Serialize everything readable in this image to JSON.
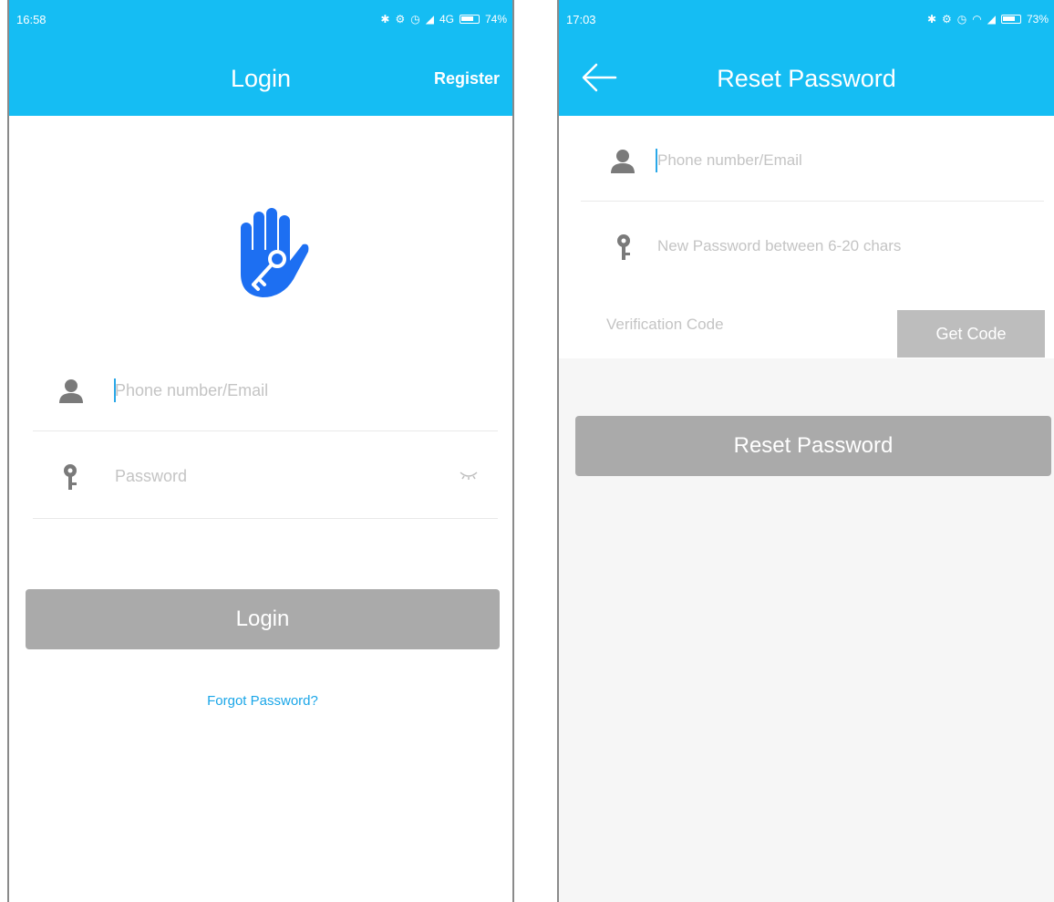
{
  "left_screen": {
    "status": {
      "time": "16:58",
      "network": "4G",
      "battery": "74%"
    },
    "title": "Login",
    "register_label": "Register",
    "phone_placeholder": "Phone number/Email",
    "password_placeholder": "Password",
    "login_button": "Login",
    "forgot_password": "Forgot Password?"
  },
  "right_screen": {
    "status": {
      "time": "17:03",
      "battery": "73%"
    },
    "title": "Reset Password",
    "phone_placeholder": "Phone number/Email",
    "new_password_placeholder": "New Password between 6-20 chars",
    "verification_placeholder": "Verification Code",
    "get_code_button": "Get Code",
    "reset_button": "Reset Password"
  },
  "colors": {
    "accent": "#15bdf3",
    "logo_blue": "#1d6ff2",
    "link_blue": "#1aa6e8",
    "button_gray": "#aaaaaa",
    "icon_gray": "#7a7a7a"
  },
  "icons": [
    "hand-key-logo-icon",
    "user-icon",
    "key-icon",
    "eye-closed-icon",
    "back-arrow-icon",
    "bluetooth-icon",
    "signal-icon",
    "wifi-icon",
    "alarm-icon",
    "battery-icon"
  ]
}
